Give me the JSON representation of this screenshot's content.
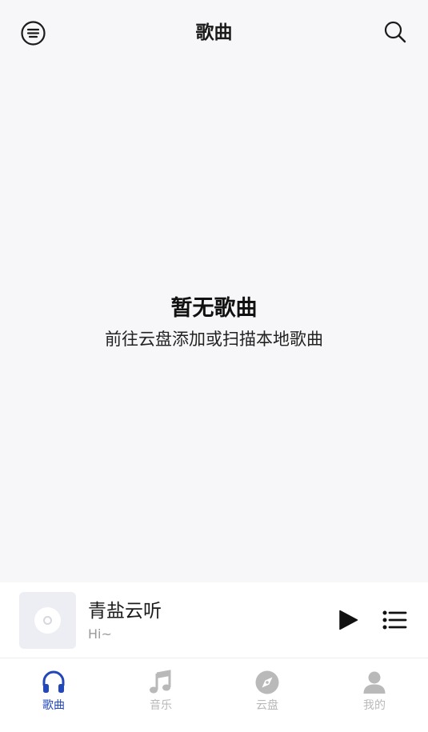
{
  "header": {
    "title": "歌曲",
    "menu_icon": "menu-circle-icon",
    "search_icon": "search-icon"
  },
  "empty_state": {
    "heading": "暂无歌曲",
    "message": "前往云盘添加或扫描本地歌曲"
  },
  "player": {
    "title": "青盐云听",
    "subtitle": "Hi~",
    "cover_icon": "disc-icon",
    "play_icon": "play-icon",
    "queue_icon": "playlist-icon"
  },
  "nav": {
    "tabs": [
      {
        "label": "歌曲",
        "icon": "headphones-icon",
        "active": true
      },
      {
        "label": "音乐",
        "icon": "music-note-icon",
        "active": false
      },
      {
        "label": "云盘",
        "icon": "compass-icon",
        "active": false
      },
      {
        "label": "我的",
        "icon": "user-icon",
        "active": false
      }
    ]
  },
  "colors": {
    "background": "#f7f7f9",
    "accent": "#2147b8",
    "inactive": "#b9b9b9",
    "text": "#1b1b1b"
  }
}
